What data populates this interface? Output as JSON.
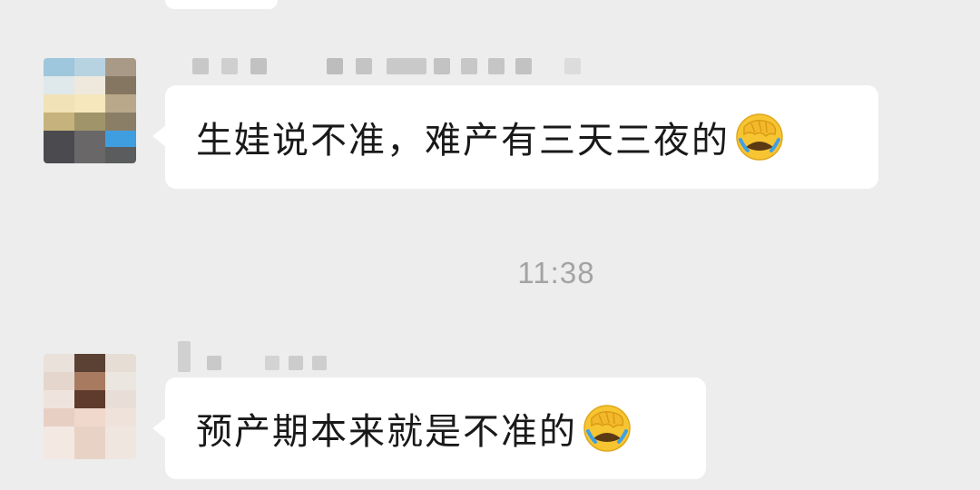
{
  "chat": {
    "timestamp": "11:38",
    "messages": [
      {
        "sender": "contact-1",
        "text": "生娃说不准，难产有三天三夜的",
        "emoji": "face-palm-crying-emoji"
      },
      {
        "sender": "contact-2",
        "text": "预产期本来就是不准的",
        "emoji": "face-palm-crying-emoji"
      }
    ]
  },
  "colors": {
    "background": "#ededed",
    "bubble": "#ffffff",
    "text": "#191919",
    "timestamp": "#a3a3a3"
  }
}
